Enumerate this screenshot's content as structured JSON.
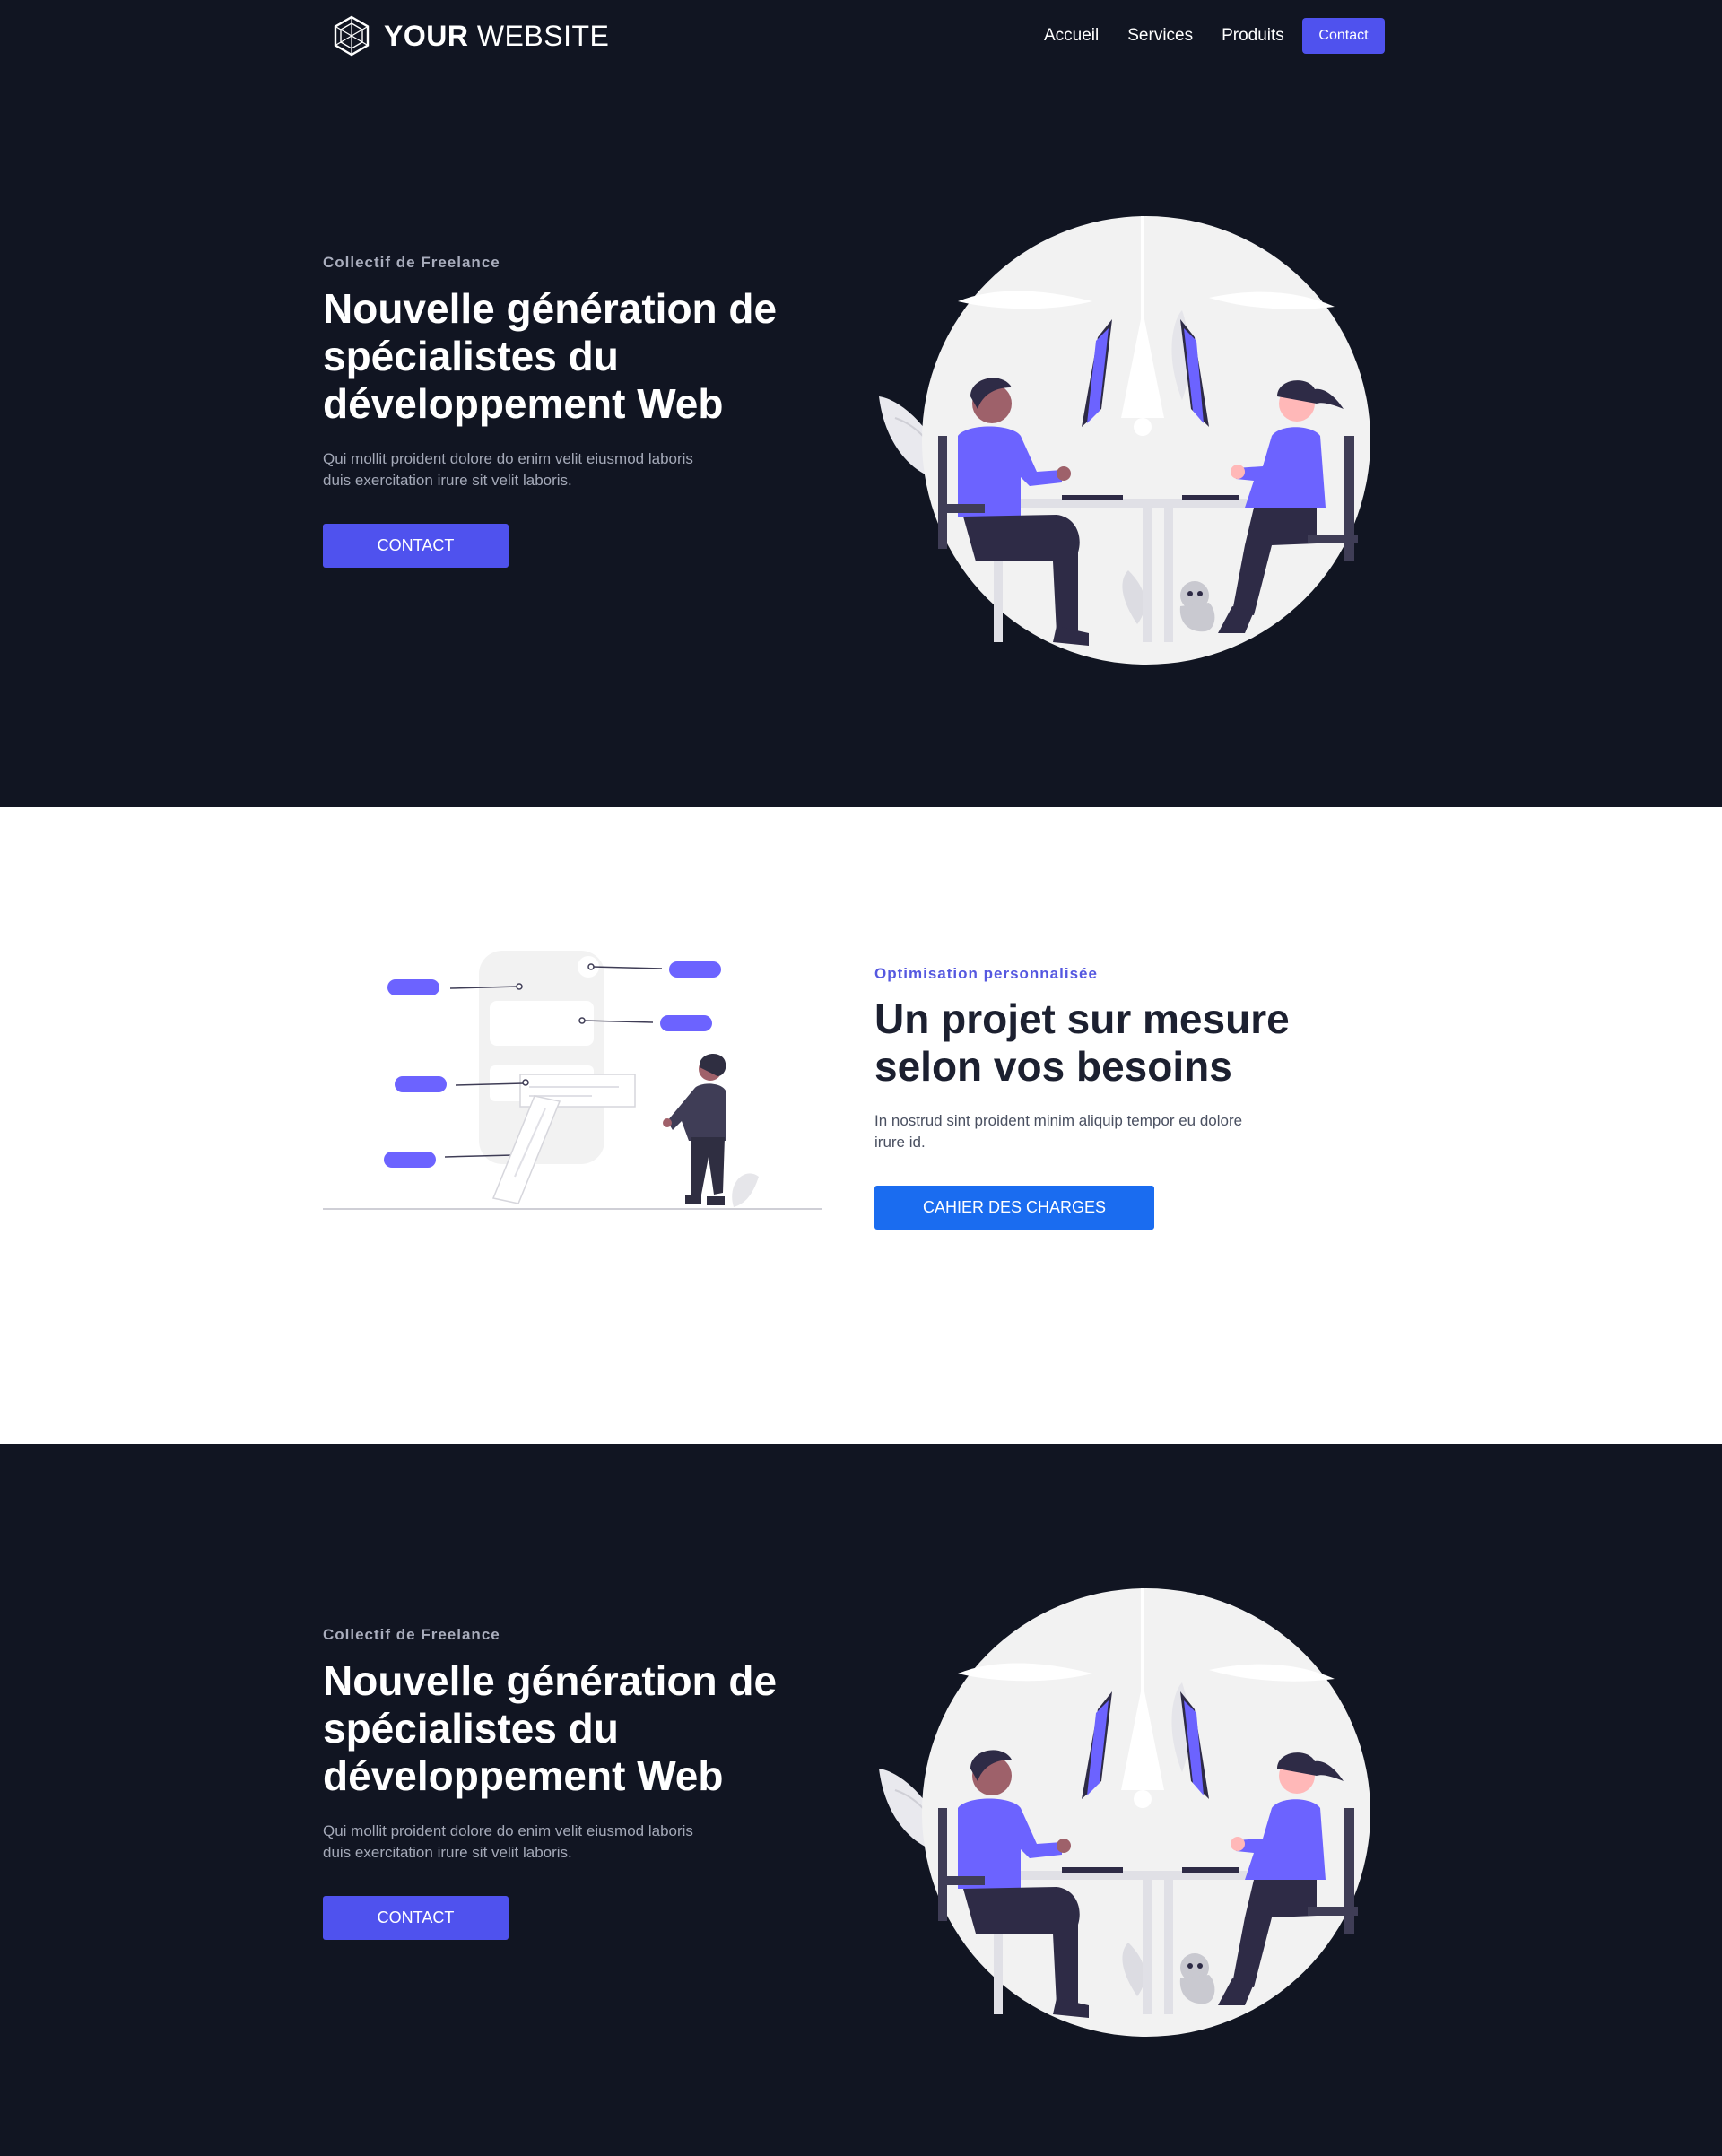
{
  "nav": {
    "logo_bold": "YOUR",
    "logo_light": "WEBSITE",
    "links": [
      "Accueil",
      "Services",
      "Produits"
    ],
    "cta": "Contact"
  },
  "hero": {
    "eyebrow": "Collectif de Freelance",
    "title": "Nouvelle génération de spécialistes du développement Web",
    "text": "Qui mollit proident dolore do enim velit eiusmod laboris duis exercitation irure sit velit laboris.",
    "button": "CONTACT"
  },
  "project": {
    "eyebrow": "Optimisation personnalisée",
    "title": "Un projet sur mesure selon vos besoins",
    "text": "In nostrud sint proident minim aliquip tempor eu dolore irure id.",
    "button": "CAHIER DES CHARGES"
  },
  "hero_repeat": {
    "eyebrow": "Collectif de Freelance",
    "title": "Nouvelle génération de spécialistes du développement Web",
    "text": "Qui mollit proident dolore do enim velit eiusmod laboris duis exercitation irure sit velit laboris.",
    "button": "CONTACT"
  },
  "colors": {
    "dark_bg": "#111522",
    "accent": "#4f52ee",
    "blue_button": "#1a6cf0",
    "illustration_purple": "#6c63ff"
  },
  "icons": [
    "logo-hexagon-icon"
  ]
}
